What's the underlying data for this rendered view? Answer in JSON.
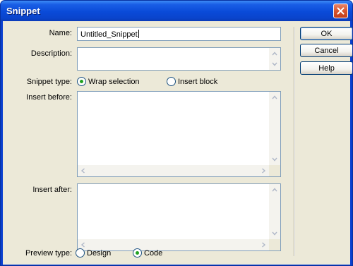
{
  "window": {
    "title": "Snippet"
  },
  "form": {
    "name_label": "Name:",
    "name_value": "Untitled_Snippet",
    "description_label": "Description:",
    "description_value": "",
    "snippet_type_label": "Snippet type:",
    "snippet_type_options": [
      {
        "label": "Wrap selection",
        "selected": true
      },
      {
        "label": "Insert block",
        "selected": false
      }
    ],
    "insert_before_label": "Insert before:",
    "insert_before_value": "",
    "insert_after_label": "Insert after:",
    "insert_after_value": "",
    "preview_type_label": "Preview type:",
    "preview_type_options": [
      {
        "label": "Design",
        "selected": false
      },
      {
        "label": "Code",
        "selected": true
      }
    ]
  },
  "buttons": {
    "ok": "OK",
    "cancel": "Cancel",
    "help": "Help"
  },
  "colors": {
    "title_bar": "#0a4ad8",
    "dialog_bg": "#ece9d8",
    "field_border": "#7f9db9",
    "radio_dot": "#21a121"
  }
}
